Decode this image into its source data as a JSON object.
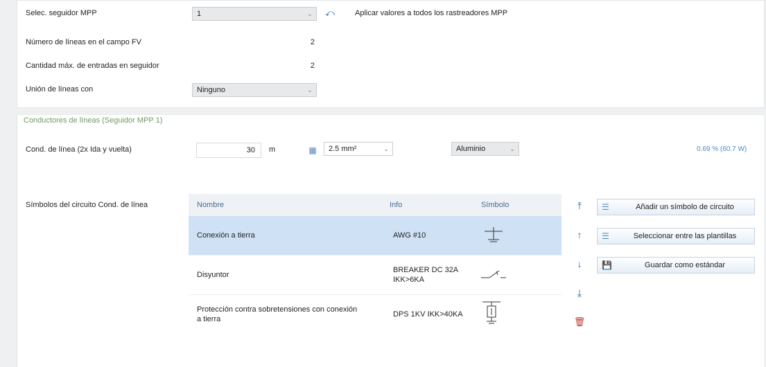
{
  "top": {
    "mpp_label": "Selec. seguidor MPP",
    "mpp_value": "1",
    "apply_label": "Aplicar valores a todos los rastreadores MPP",
    "lines_label": "Número de líneas en el campo FV",
    "lines_value": "2",
    "max_inputs_label": "Cantidad máx. de entradas en seguidor",
    "max_inputs_value": "2",
    "join_label": "Unión de líneas con",
    "join_value": "Ninguno"
  },
  "section": {
    "title": "Conductores de líneas (Seguidor MPP 1)",
    "cond_label": "Cond. de línea (2x Ida y vuelta)",
    "length_value": "30",
    "length_unit": "m",
    "cross_section": "2.5 mm²",
    "material": "Aluminio",
    "loss": "0.69 % (60.7 W)",
    "symbols_label": "Símbolos del circuito Cond. de línea"
  },
  "table": {
    "headers": {
      "name": "Nombre",
      "info": "Info",
      "symbol": "Símbolo"
    },
    "rows": [
      {
        "name": "Conexión a tierra",
        "info": "AWG #10"
      },
      {
        "name": "Disyuntor",
        "info": "BREAKER DC 32A IKK>6KA"
      },
      {
        "name": "Protección contra sobretensiones con conexión a tierra",
        "info": "DPS 1KV IKK>40KA"
      }
    ]
  },
  "buttons": {
    "add_symbol": "Añadir un símbolo de circuito",
    "select_template": "Seleccionar entre las plantillas",
    "save_default": "Guardar como estándar"
  },
  "icons": {
    "apply": "apply-arrow-icon",
    "calc": "calculator-icon",
    "move_top": "move-top-icon",
    "move_up": "move-up-icon",
    "move_down": "move-down-icon",
    "move_bottom": "move-bottom-icon",
    "delete": "trash-icon"
  }
}
